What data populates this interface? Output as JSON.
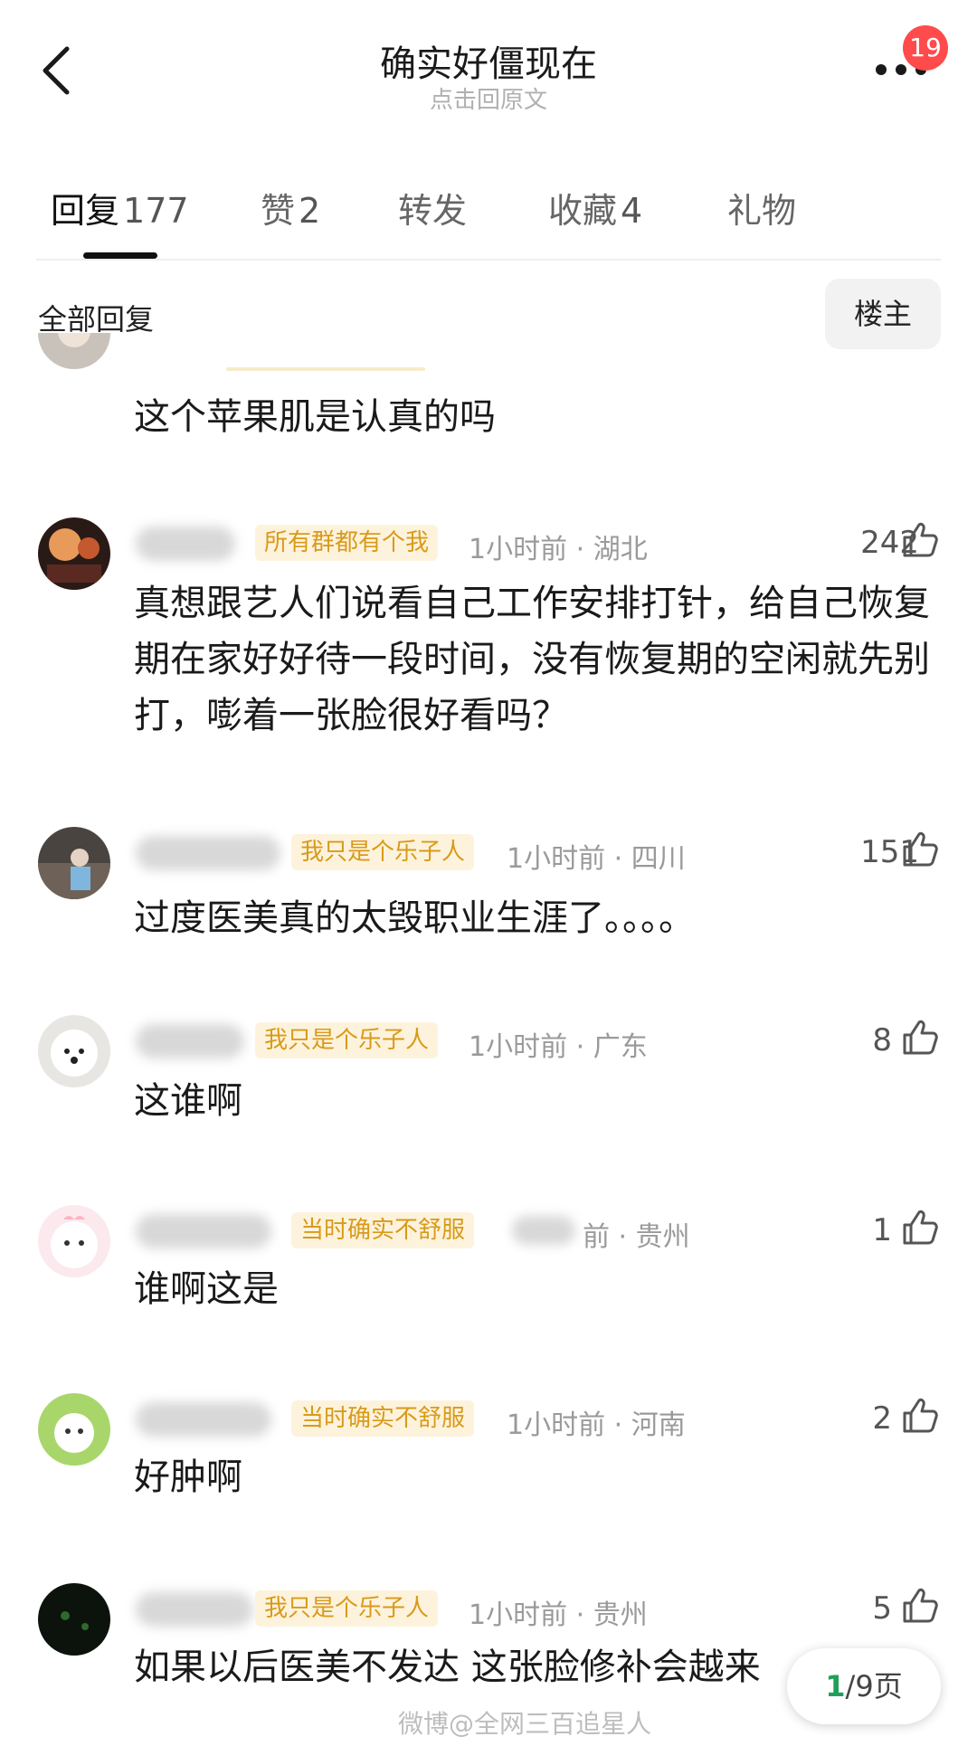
{
  "header": {
    "title": "确实好僵现在",
    "subtitle": "点击回原文",
    "badge_count": "19"
  },
  "tabs": [
    {
      "label": "回复",
      "count": "177"
    },
    {
      "label": "赞",
      "count": "2"
    },
    {
      "label": "转发",
      "count": ""
    },
    {
      "label": "收藏",
      "count": "4"
    },
    {
      "label": "礼物",
      "count": ""
    }
  ],
  "filter": {
    "label": "全部回复",
    "owner_button": "楼主"
  },
  "comments": [
    {
      "text": "这个苹果肌是认真的吗"
    },
    {
      "tag": "所有群都有个我",
      "time": "1小时前",
      "location": "湖北",
      "likes": "242",
      "text": "真想跟艺人们说看自己工作安排打针，给自己恢复期在家好好待一段时间，没有恢复期的空闲就先别打，嘭着一张脸很好看吗？"
    },
    {
      "tag": "我只是个乐子人",
      "time": "1小时前",
      "location": "四川",
      "likes": "151",
      "text": "过度医美真的太毁职业生涯了。。。。"
    },
    {
      "tag": "我只是个乐子人",
      "time": "1小时前",
      "location": "广东",
      "likes": "8",
      "text": "这谁啊"
    },
    {
      "tag": "当时确实不舒服",
      "time": "前",
      "location": "贵州",
      "likes": "1",
      "text": "谁啊这是"
    },
    {
      "tag": "当时确实不舒服",
      "time": "1小时前",
      "location": "河南",
      "likes": "2",
      "text": "好肿啊"
    },
    {
      "tag": "我只是个乐子人",
      "time": "1小时前",
      "location": "贵州",
      "likes": "5",
      "text": "如果以后医美不发达 这张脸修补会越来"
    }
  ],
  "pager": {
    "current": "1",
    "total": "/9页"
  },
  "watermark": "微博@全网三百追星人",
  "colors": {
    "tag_bg": "#fdf3dc",
    "tag_text": "#d99a1a",
    "badge": "#ff4b4b",
    "page_current": "#1fa05a"
  }
}
